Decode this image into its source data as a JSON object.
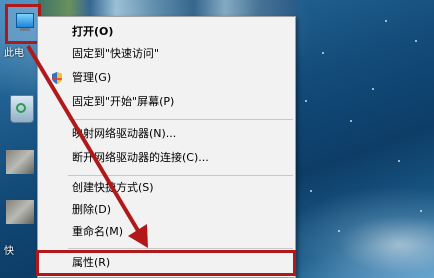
{
  "desktop": {
    "icons": [
      {
        "name": "this-pc",
        "label": "此电"
      },
      {
        "name": "recycle-bin",
        "label": ""
      },
      {
        "name": "shortcut",
        "label": "快"
      }
    ]
  },
  "context_menu": {
    "items": [
      {
        "label": "打开(O)",
        "bold": true
      },
      {
        "label": "固定到\"快速访问\""
      },
      {
        "label": "管理(G)",
        "icon": "shield-icon"
      },
      {
        "label": "固定到\"开始\"屏幕(P)"
      },
      {
        "label": "映射网络驱动器(N)..."
      },
      {
        "label": "断开网络驱动器的连接(C)..."
      },
      {
        "label": "创建快捷方式(S)"
      },
      {
        "label": "删除(D)"
      },
      {
        "label": "重命名(M)"
      },
      {
        "label": "属性(R)",
        "highlighted": true
      }
    ]
  },
  "annotation": {
    "color": "#b0181a"
  }
}
